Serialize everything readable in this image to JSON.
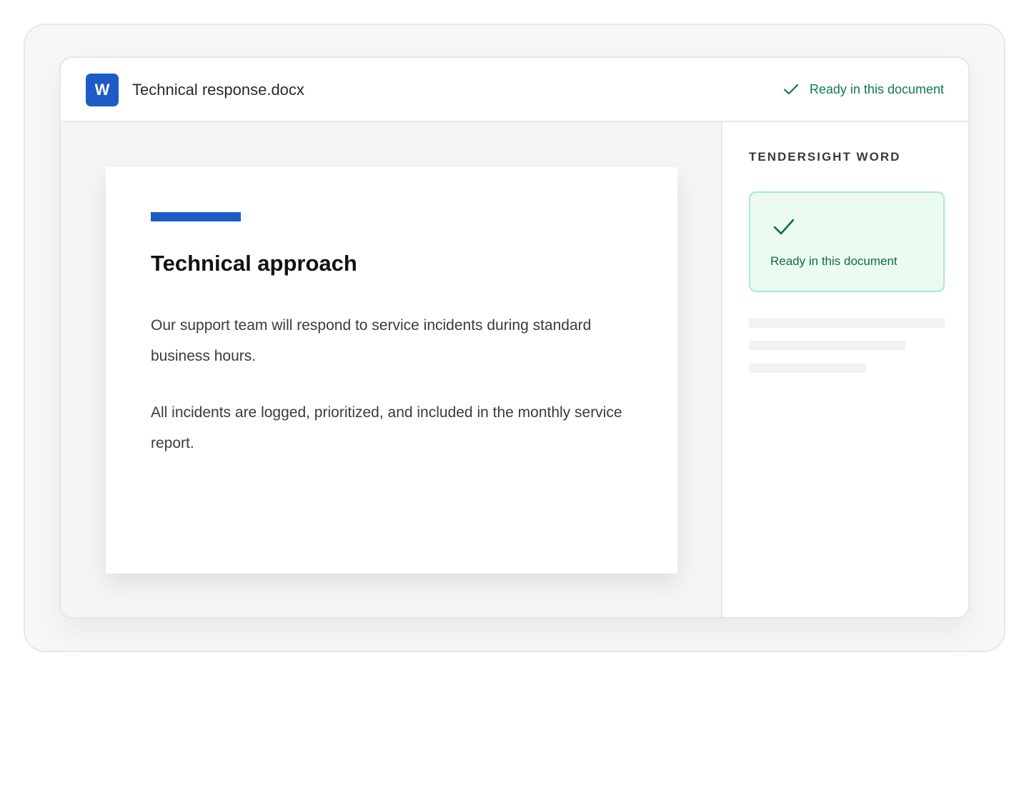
{
  "app": {
    "icon_letter": "W",
    "brand_color": "#1e5bc6",
    "icon": "word-logo-icon"
  },
  "titlebar": {
    "file_name": "Technical response.docx",
    "status_label": "Ready in this document",
    "status_icon": "check-icon",
    "status_color": "#117a4d"
  },
  "document": {
    "heading": "Technical approach",
    "paragraphs": [
      "Our support team will respond to service incidents during standard business hours.",
      "All incidents are logged, prioritized, and included in the monthly service report."
    ],
    "accent_color": "#1e5bc6"
  },
  "side_panel": {
    "title": "TENDERSIGHT WORD",
    "card": {
      "icon": "check-icon",
      "label": "Ready in this document",
      "background": "#ebfbf1",
      "border": "#a9ead0"
    }
  }
}
